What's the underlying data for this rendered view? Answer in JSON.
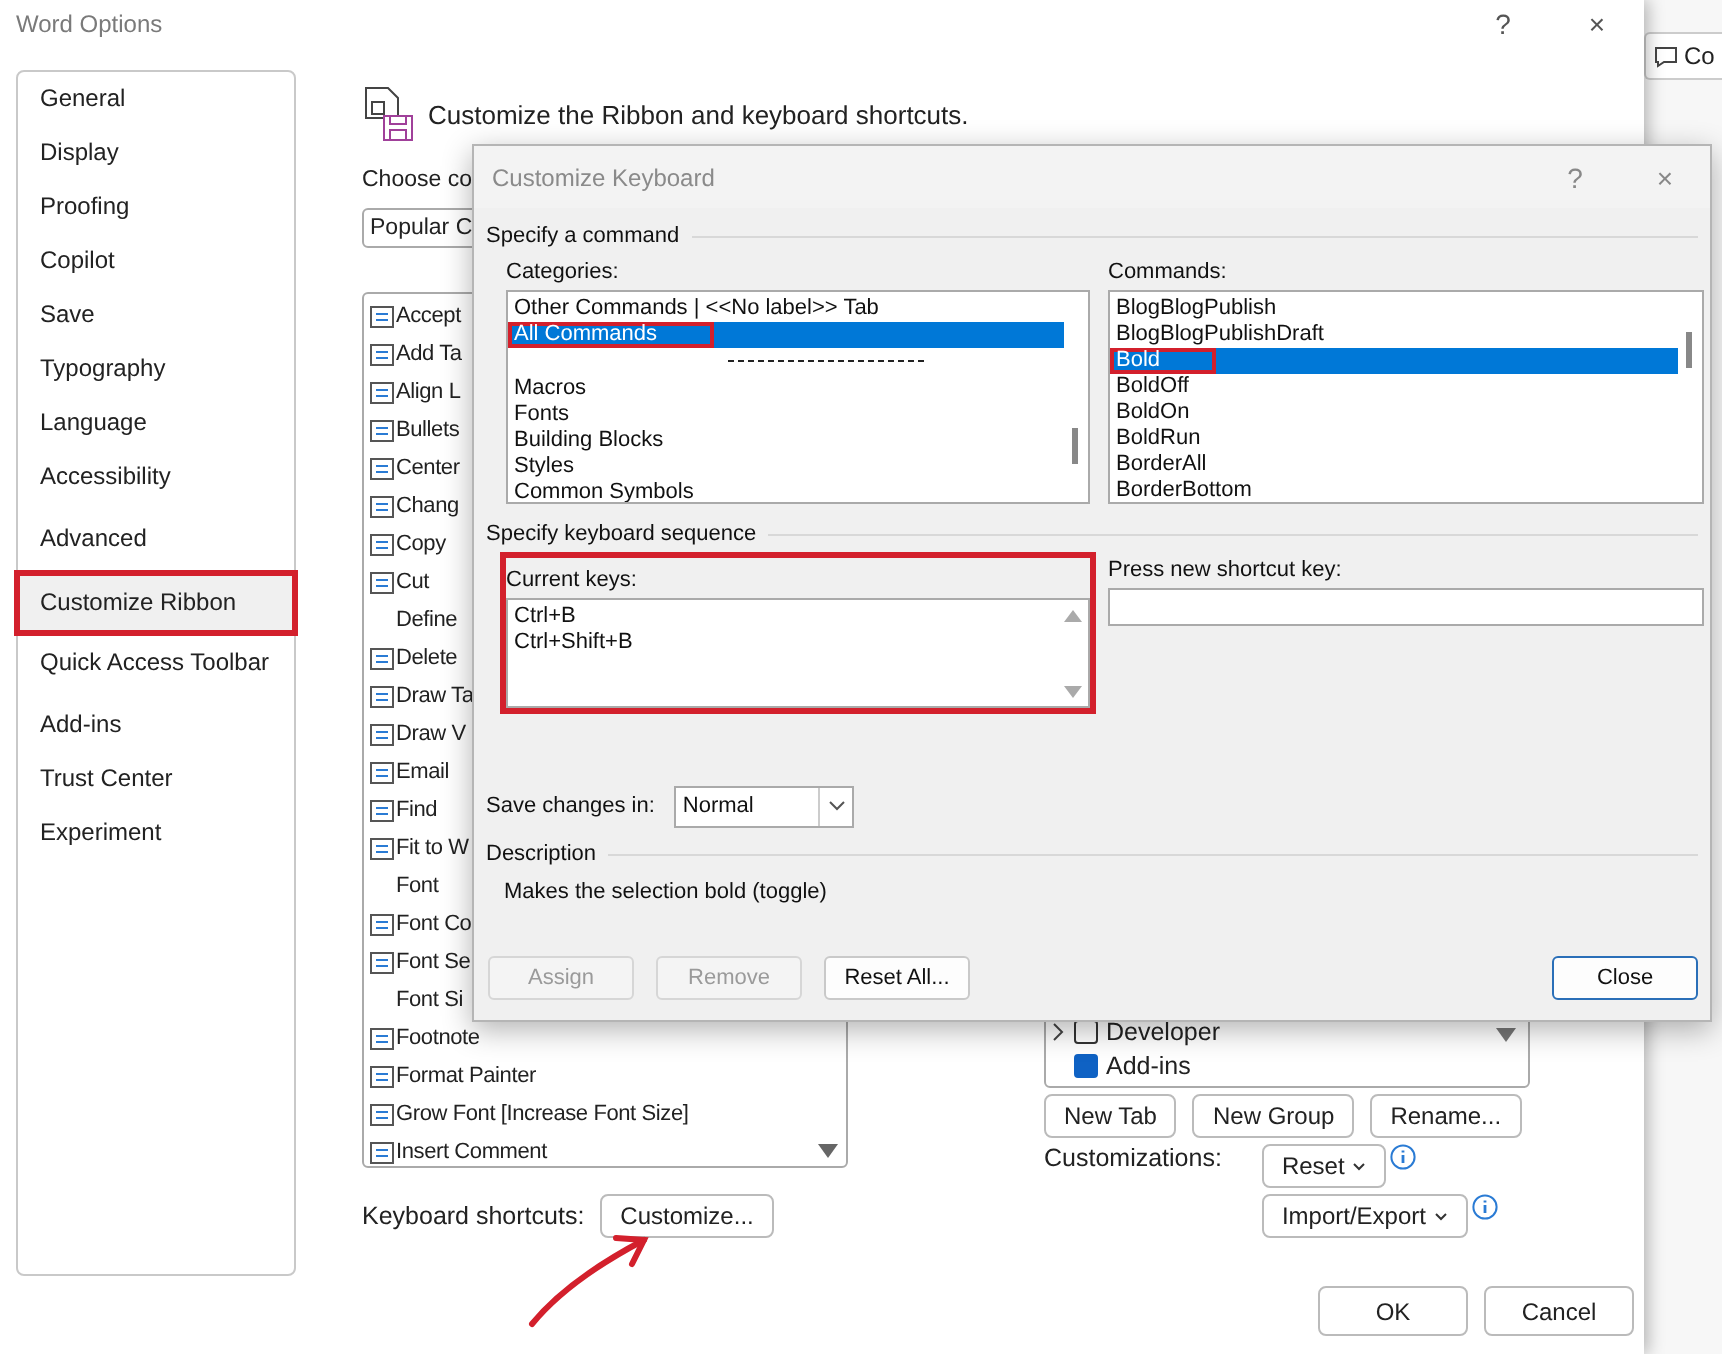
{
  "window": {
    "title": "Word Options",
    "title_buttons": [
      "?",
      "×"
    ]
  },
  "behind_button": {
    "label": "Co"
  },
  "sidebar": {
    "groups": [
      {
        "items": [
          {
            "label": "General",
            "selected": false,
            "highlighted": false
          },
          {
            "label": "Display",
            "selected": false,
            "highlighted": false
          },
          {
            "label": "Proofing",
            "selected": false,
            "highlighted": false
          },
          {
            "label": "Copilot",
            "selected": false,
            "highlighted": false
          },
          {
            "label": "Save",
            "selected": false,
            "highlighted": false
          },
          {
            "label": "Typography",
            "selected": false,
            "highlighted": false
          },
          {
            "label": "Language",
            "selected": false,
            "highlighted": false
          },
          {
            "label": "Accessibility",
            "selected": false,
            "highlighted": false
          }
        ]
      },
      {
        "items": [
          {
            "label": "Advanced",
            "selected": false,
            "highlighted": false
          }
        ]
      },
      {
        "items": [
          {
            "label": "Customize Ribbon",
            "selected": true,
            "highlighted": true
          },
          {
            "label": "Quick Access Toolbar",
            "selected": false,
            "highlighted": false
          }
        ]
      },
      {
        "items": [
          {
            "label": "Add-ins",
            "selected": false,
            "highlighted": false
          },
          {
            "label": "Trust Center",
            "selected": false,
            "highlighted": false
          },
          {
            "label": "Experiment",
            "selected": false,
            "highlighted": false
          }
        ]
      }
    ]
  },
  "heading": "Customize the Ribbon and keyboard shortcuts.",
  "choose_label": "Choose co",
  "choose_dropdown": {
    "value": "Popular C"
  },
  "commands_list": {
    "items": [
      {
        "label": "Accept",
        "icon": true
      },
      {
        "label": "Add Ta",
        "icon": true
      },
      {
        "label": "Align L",
        "icon": true
      },
      {
        "label": "Bullets",
        "icon": true
      },
      {
        "label": "Center",
        "icon": true
      },
      {
        "label": "Chang",
        "icon": true
      },
      {
        "label": "Copy",
        "icon": true
      },
      {
        "label": "Cut",
        "icon": true
      },
      {
        "label": "Define",
        "icon": false
      },
      {
        "label": "Delete",
        "icon": true
      },
      {
        "label": "Draw Ta",
        "icon": true
      },
      {
        "label": "Draw V",
        "icon": true
      },
      {
        "label": "Email",
        "icon": true
      },
      {
        "label": "Find",
        "icon": true
      },
      {
        "label": "Fit to W",
        "icon": true
      },
      {
        "label": "Font",
        "icon": false
      },
      {
        "label": "Font Co",
        "icon": true
      },
      {
        "label": "Font Se",
        "icon": true
      },
      {
        "label": "Font Si",
        "icon": false
      },
      {
        "label": "Footnote",
        "icon": true
      },
      {
        "label": "Format Painter",
        "icon": true
      },
      {
        "label": "Grow Font [Increase Font Size]",
        "icon": true
      },
      {
        "label": "Insert Comment",
        "icon": true
      }
    ]
  },
  "keyboard_shortcuts": {
    "label": "Keyboard shortcuts:",
    "button": "Customize...",
    "pointed_at": true
  },
  "tabs_tree": {
    "items": [
      {
        "label": "Developer",
        "checked": false
      },
      {
        "label": "Add-ins",
        "checked": true
      }
    ]
  },
  "tree_buttons": [
    "New Tab",
    "New Group",
    "Rename..."
  ],
  "customizations": {
    "label": "Customizations:",
    "buttons": [
      "Reset",
      "Import/Export"
    ]
  },
  "footer_buttons": [
    "OK",
    "Cancel"
  ],
  "dialog": {
    "title": "Customize Keyboard",
    "title_buttons": [
      "?",
      "×"
    ],
    "command_section": "Specify a command",
    "categories": {
      "label": "Categories:",
      "items": [
        {
          "kind": "item",
          "label": "Other Commands | <<No label>> Tab",
          "selected": false,
          "highlighted": false
        },
        {
          "kind": "item",
          "label": "All Commands",
          "selected": true,
          "highlighted": true
        },
        {
          "kind": "separator"
        },
        {
          "kind": "item",
          "label": "Macros",
          "selected": false,
          "highlighted": false
        },
        {
          "kind": "item",
          "label": "Fonts",
          "selected": false,
          "highlighted": false
        },
        {
          "kind": "item",
          "label": "Building Blocks",
          "selected": false,
          "highlighted": false
        },
        {
          "kind": "item",
          "label": "Styles",
          "selected": false,
          "highlighted": false
        },
        {
          "kind": "item",
          "label": "Common Symbols",
          "selected": false,
          "highlighted": false
        }
      ]
    },
    "commands": {
      "label": "Commands:",
      "items": [
        {
          "kind": "item",
          "label": "BlogBlogPublish",
          "selected": false,
          "highlighted": false
        },
        {
          "kind": "item",
          "label": "BlogBlogPublishDraft",
          "selected": false,
          "highlighted": false
        },
        {
          "kind": "item",
          "label": "Bold",
          "selected": true,
          "highlighted": true
        },
        {
          "kind": "item",
          "label": "BoldOff",
          "selected": false,
          "highlighted": false
        },
        {
          "kind": "item",
          "label": "BoldOn",
          "selected": false,
          "highlighted": false
        },
        {
          "kind": "item",
          "label": "BoldRun",
          "selected": false,
          "highlighted": false
        },
        {
          "kind": "item",
          "label": "BorderAll",
          "selected": false,
          "highlighted": false
        },
        {
          "kind": "item",
          "label": "BorderBottom",
          "selected": false,
          "highlighted": false
        }
      ]
    },
    "sequence_section": "Specify keyboard sequence",
    "current_keys": {
      "label": "Current keys:",
      "keys": [
        "Ctrl+B",
        "Ctrl+Shift+B"
      ],
      "highlighted": true
    },
    "new_key": {
      "label": "Press new shortcut key:"
    },
    "save_in": {
      "label": "Save changes in:",
      "value": "Normal"
    },
    "description": {
      "label": "Description",
      "text": "Makes the selection bold (toggle)"
    },
    "buttons": [
      {
        "label": "Assign",
        "disabled": true,
        "default": false
      },
      {
        "label": "Remove",
        "disabled": true,
        "default": false
      },
      {
        "label": "Reset All...",
        "disabled": false,
        "default": false
      },
      {
        "label": "Close",
        "disabled": false,
        "default": true
      }
    ]
  }
}
